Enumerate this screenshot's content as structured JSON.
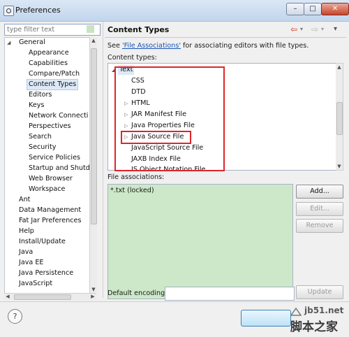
{
  "window": {
    "title": "Preferences",
    "minimize_glyph": "–",
    "maximize_glyph": "□",
    "close_glyph": "✕"
  },
  "sidebar": {
    "filter_placeholder": "type filter text",
    "items": [
      {
        "label": "General"
      },
      {
        "label": "Appearance"
      },
      {
        "label": "Capabilities"
      },
      {
        "label": "Compare/Patch"
      },
      {
        "label": "Content Types"
      },
      {
        "label": "Editors"
      },
      {
        "label": "Keys"
      },
      {
        "label": "Network Connecti"
      },
      {
        "label": "Perspectives"
      },
      {
        "label": "Search"
      },
      {
        "label": "Security"
      },
      {
        "label": "Service Policies"
      },
      {
        "label": "Startup and Shutd"
      },
      {
        "label": "Web Browser"
      },
      {
        "label": "Workspace"
      },
      {
        "label": "Ant"
      },
      {
        "label": "Data Management"
      },
      {
        "label": "Fat Jar Preferences"
      },
      {
        "label": "Help"
      },
      {
        "label": "Install/Update"
      },
      {
        "label": "Java"
      },
      {
        "label": "Java EE"
      },
      {
        "label": "Java Persistence"
      },
      {
        "label": "JavaScript"
      }
    ],
    "selected": "Content Types"
  },
  "page": {
    "title": "Content Types",
    "description_prefix": "See ",
    "description_link": "'File Associations'",
    "description_suffix": " for associating editors with file types.",
    "content_types_label": "Content types:",
    "content_types": [
      {
        "label": "Text"
      },
      {
        "label": "CSS"
      },
      {
        "label": "DTD"
      },
      {
        "label": "HTML"
      },
      {
        "label": "JAR Manifest File"
      },
      {
        "label": "Java Properties File"
      },
      {
        "label": "Java Source File"
      },
      {
        "label": "JavaScript Source File"
      },
      {
        "label": "JAXB Index File"
      },
      {
        "label": "JS Object Notation File"
      }
    ],
    "file_associations_label": "File associations:",
    "file_associations": [
      "*.txt (locked)"
    ],
    "buttons": {
      "add": "Add...",
      "edit": "Edit...",
      "remove": "Remove",
      "update": "Update"
    },
    "default_encoding_label": "Default encoding:",
    "default_encoding_value": ""
  },
  "footer": {
    "help": "?"
  },
  "nav": {
    "back": "⇦",
    "forward": "⇨"
  },
  "watermark": {
    "url": "jb51.net",
    "cn": "脚本之家"
  },
  "colors": {
    "annotation_red": "#e1242a",
    "selection": "#dde9f7",
    "associations_bg": "#cde8c8",
    "link": "#1a55b5"
  }
}
